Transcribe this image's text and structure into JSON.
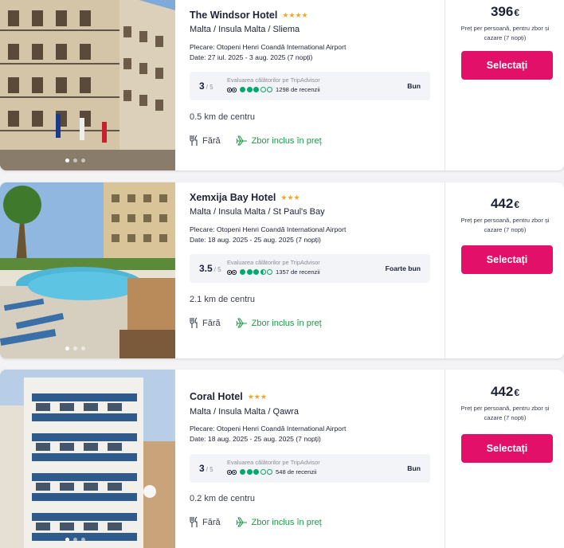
{
  "hotels": [
    {
      "name": "The Windsor Hotel",
      "stars": "★★★★",
      "location": "Malta / Insula Malta / Sliema",
      "departure": "Plecare: Otopeni Henri Coandă International Airport",
      "dates": "Date: 27 iul. 2025 - 3 aug. 2025 (7 nopți)",
      "rating": {
        "score": "3",
        "scale": "/ 5",
        "source_label": "Evaluarea călătorilor pe TripAdvisor",
        "reviews": "1298 de recenzii",
        "bubbles": 3,
        "verdict": "Bun"
      },
      "distance": "0.5 km de centru",
      "meal": "Fără",
      "flight": "Zbor inclus în preț",
      "price": "396",
      "currency": "€",
      "price_note": "Preț per persoană, pentru zbor și cazare (7 nopți)",
      "select_label": "Selectați"
    },
    {
      "name": "Xemxija Bay Hotel",
      "stars": "★★★",
      "location": "Malta / Insula Malta / St Paul's Bay",
      "departure": "Plecare: Otopeni Henri Coandă International Airport",
      "dates": "Date: 18 aug. 2025 - 25 aug. 2025 (7 nopți)",
      "rating": {
        "score": "3.5",
        "scale": "/ 5",
        "source_label": "Evaluarea călătorilor pe TripAdvisor",
        "reviews": "1357 de recenzii",
        "bubbles": 3.5,
        "verdict": "Foarte bun"
      },
      "distance": "2.1 km de centru",
      "meal": "Fără",
      "flight": "Zbor inclus în preț",
      "price": "442",
      "currency": "€",
      "price_note": "Preț per persoană, pentru zbor și cazare (7 nopți)",
      "select_label": "Selectați"
    },
    {
      "name": "Coral Hotel",
      "stars": "★★★",
      "location": "Malta / Insula Malta / Qawra",
      "departure": "Plecare: Otopeni Henri Coandă International Airport",
      "dates": "Date: 18 aug. 2025 - 25 aug. 2025 (7 nopți)",
      "rating": {
        "score": "3",
        "scale": "/ 5",
        "source_label": "Evaluarea călătorilor pe TripAdvisor",
        "reviews": "548 de recenzii",
        "bubbles": 3,
        "verdict": "Bun"
      },
      "distance": "0.2 km de centru",
      "meal": "Fără",
      "flight": "Zbor inclus în preț",
      "price": "442",
      "currency": "€",
      "price_note": "Preț per persoană, pentru zbor și cazare (7 nopți)",
      "select_label": "Selectați"
    }
  ],
  "colors": {
    "accent": "#e3106a",
    "flight_green": "#1a9b4a",
    "tripadvisor_green": "#00aa6c",
    "star": "#f5a623"
  },
  "icons": {
    "meal": "fork-knife-icon",
    "flight": "plane-icon",
    "tripadvisor": "tripadvisor-owl-icon"
  }
}
